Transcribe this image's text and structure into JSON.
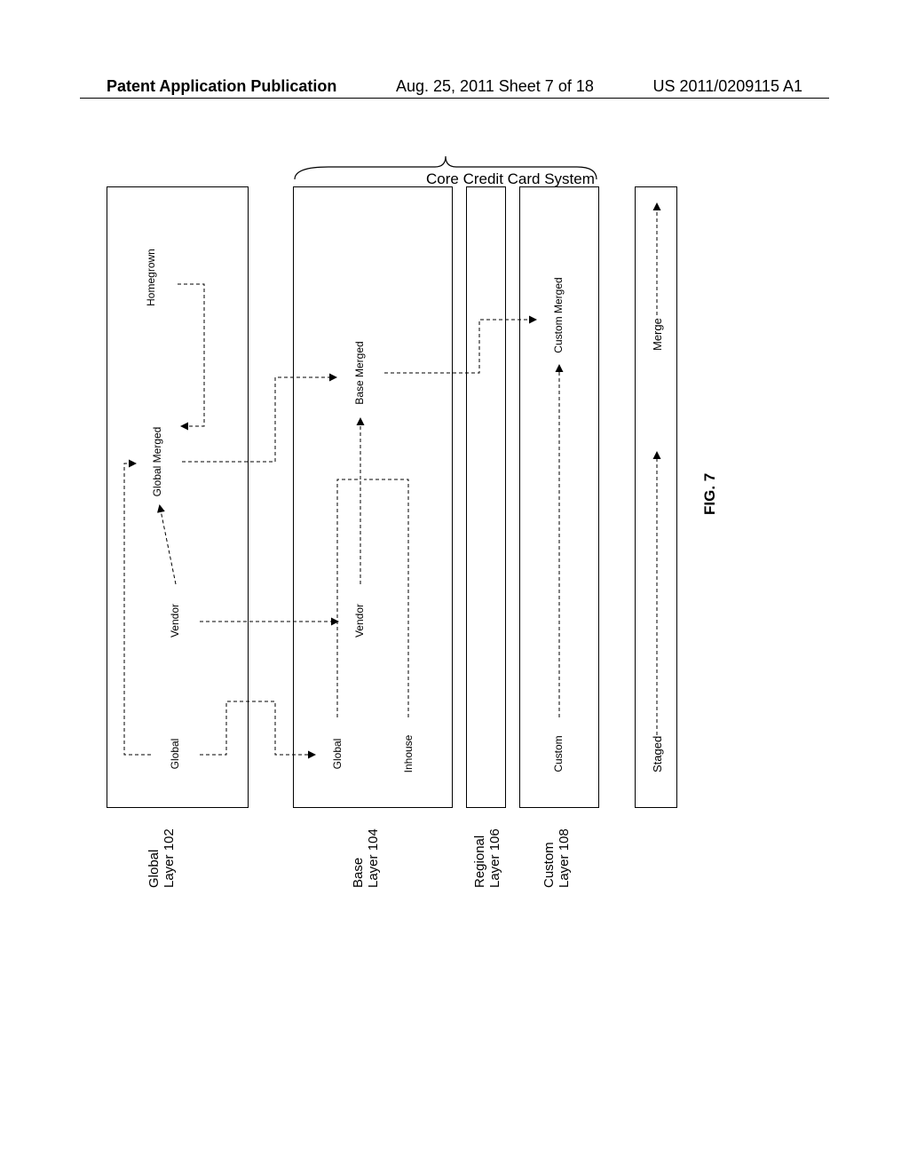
{
  "header": {
    "left": "Patent Application Publication",
    "mid": "Aug. 25, 2011  Sheet 7 of 18",
    "right": "US 2011/0209115 A1"
  },
  "labels": {
    "global_layer": "Global\nLayer 102",
    "base_layer": "Base\nLayer 104",
    "regional_layer": "Regional\nLayer 106",
    "custom_layer": "Custom\nLayer 108",
    "core_system": "Core Credit Card System",
    "fig": "FIG. 7"
  },
  "hex": {
    "g_global": "Global",
    "g_vendor": "Vendor",
    "g_global_merged": "Global Merged",
    "g_homegrown": "Homegrown",
    "b_global": "Global",
    "b_inhouse": "Inhouse",
    "b_vendor": "Vendor",
    "b_base_merged": "Base Merged",
    "c_custom": "Custom",
    "c_custom_merged": "Custom Merged"
  },
  "bottom": {
    "staged": "Staged",
    "merge": "Merge"
  }
}
